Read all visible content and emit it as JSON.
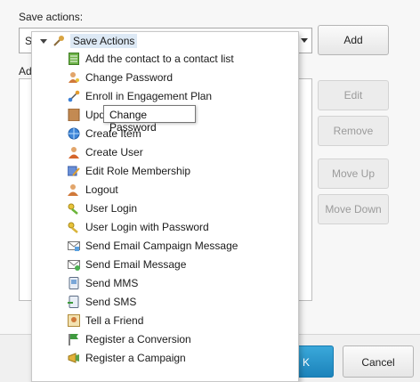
{
  "dialog": {
    "save_actions_label": "Save actions:",
    "select_value": "S",
    "actions_label": "Ad",
    "buttons": {
      "add": "Add",
      "edit": "Edit",
      "remove": "Remove",
      "move_up": "Move Up",
      "move_down": "Move Down",
      "ok": "K",
      "cancel": "Cancel"
    }
  },
  "popup": {
    "root": "Save Actions",
    "items": [
      {
        "label": "Add the contact to a contact list",
        "icon": "contact-list-icon"
      },
      {
        "label": "Change Password",
        "icon": "user-key-icon"
      },
      {
        "label": "Enroll in Engagement Plan",
        "icon": "engagement-plan-icon"
      },
      {
        "label": "Upd",
        "icon": "book-icon"
      },
      {
        "label": "Create Item",
        "icon": "globe-item-icon"
      },
      {
        "label": "Create User",
        "icon": "user-icon"
      },
      {
        "label": "Edit Role Membership",
        "icon": "role-edit-icon"
      },
      {
        "label": "Logout",
        "icon": "user-logout-icon"
      },
      {
        "label": "User Login",
        "icon": "login-key-icon"
      },
      {
        "label": "User Login with Password",
        "icon": "login-key-icon"
      },
      {
        "label": "Send Email Campaign Message",
        "icon": "email-campaign-icon"
      },
      {
        "label": "Send Email Message",
        "icon": "email-icon"
      },
      {
        "label": "Send MMS",
        "icon": "mms-icon"
      },
      {
        "label": "Send SMS",
        "icon": "sms-icon"
      },
      {
        "label": "Tell a Friend",
        "icon": "tell-friend-icon"
      },
      {
        "label": "Register a Conversion",
        "icon": "flag-icon"
      },
      {
        "label": "Register a Campaign",
        "icon": "campaign-icon"
      }
    ],
    "tooltip": "Change Password"
  }
}
